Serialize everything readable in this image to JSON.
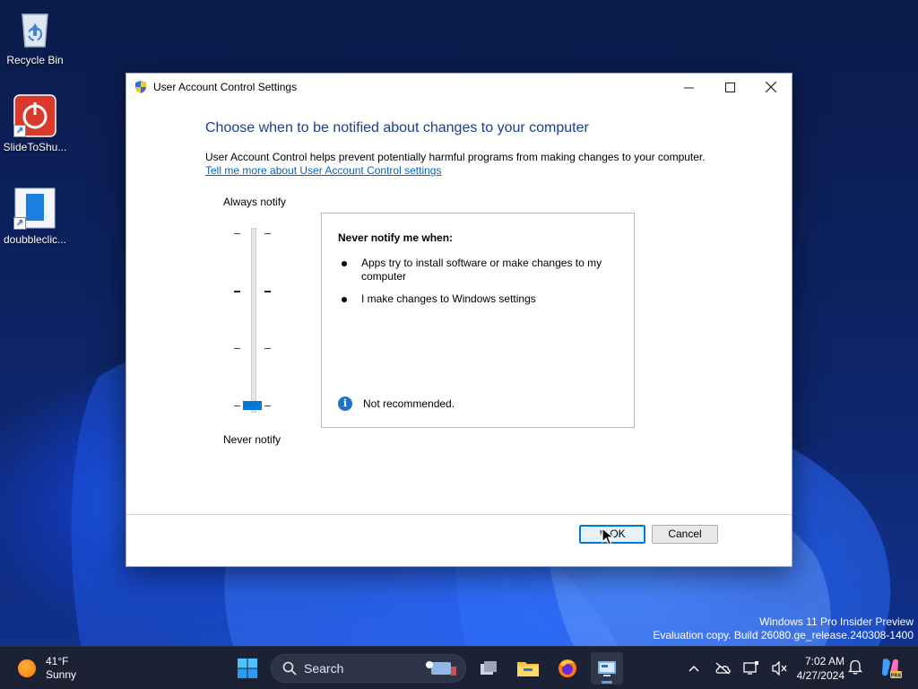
{
  "desktop": {
    "icons": [
      {
        "label": "Recycle Bin"
      },
      {
        "label": "SlideToShu..."
      },
      {
        "label": "doubbleclic..."
      }
    ],
    "watermark": {
      "line1": "Windows 11 Pro Insider Preview",
      "line2": "Evaluation copy. Build 26080.ge_release.240308-1400"
    }
  },
  "dialog": {
    "title": "User Account Control Settings",
    "heading": "Choose when to be notified about changes to your computer",
    "description": "User Account Control helps prevent potentially harmful programs from making changes to your computer.",
    "learn_more_link": "Tell me more about User Account Control settings",
    "slider": {
      "top_label": "Always notify",
      "bottom_label": "Never notify",
      "levels": 4,
      "selected_level": 0
    },
    "info": {
      "title": "Never notify me when:",
      "bullets": [
        "Apps try to install software or make changes to my computer",
        "I make changes to Windows settings"
      ],
      "note": "Not recommended."
    },
    "buttons": {
      "ok": "OK",
      "cancel": "Cancel"
    }
  },
  "taskbar": {
    "weather": {
      "temp": "41°F",
      "condition": "Sunny"
    },
    "search_placeholder": "Search",
    "clock": {
      "time": "7:02 AM",
      "date": "4/27/2024"
    }
  },
  "colors": {
    "accent": "#0078d4",
    "heading": "#1b3f8b",
    "link": "#0563c1",
    "taskbar": "#1c2233"
  }
}
